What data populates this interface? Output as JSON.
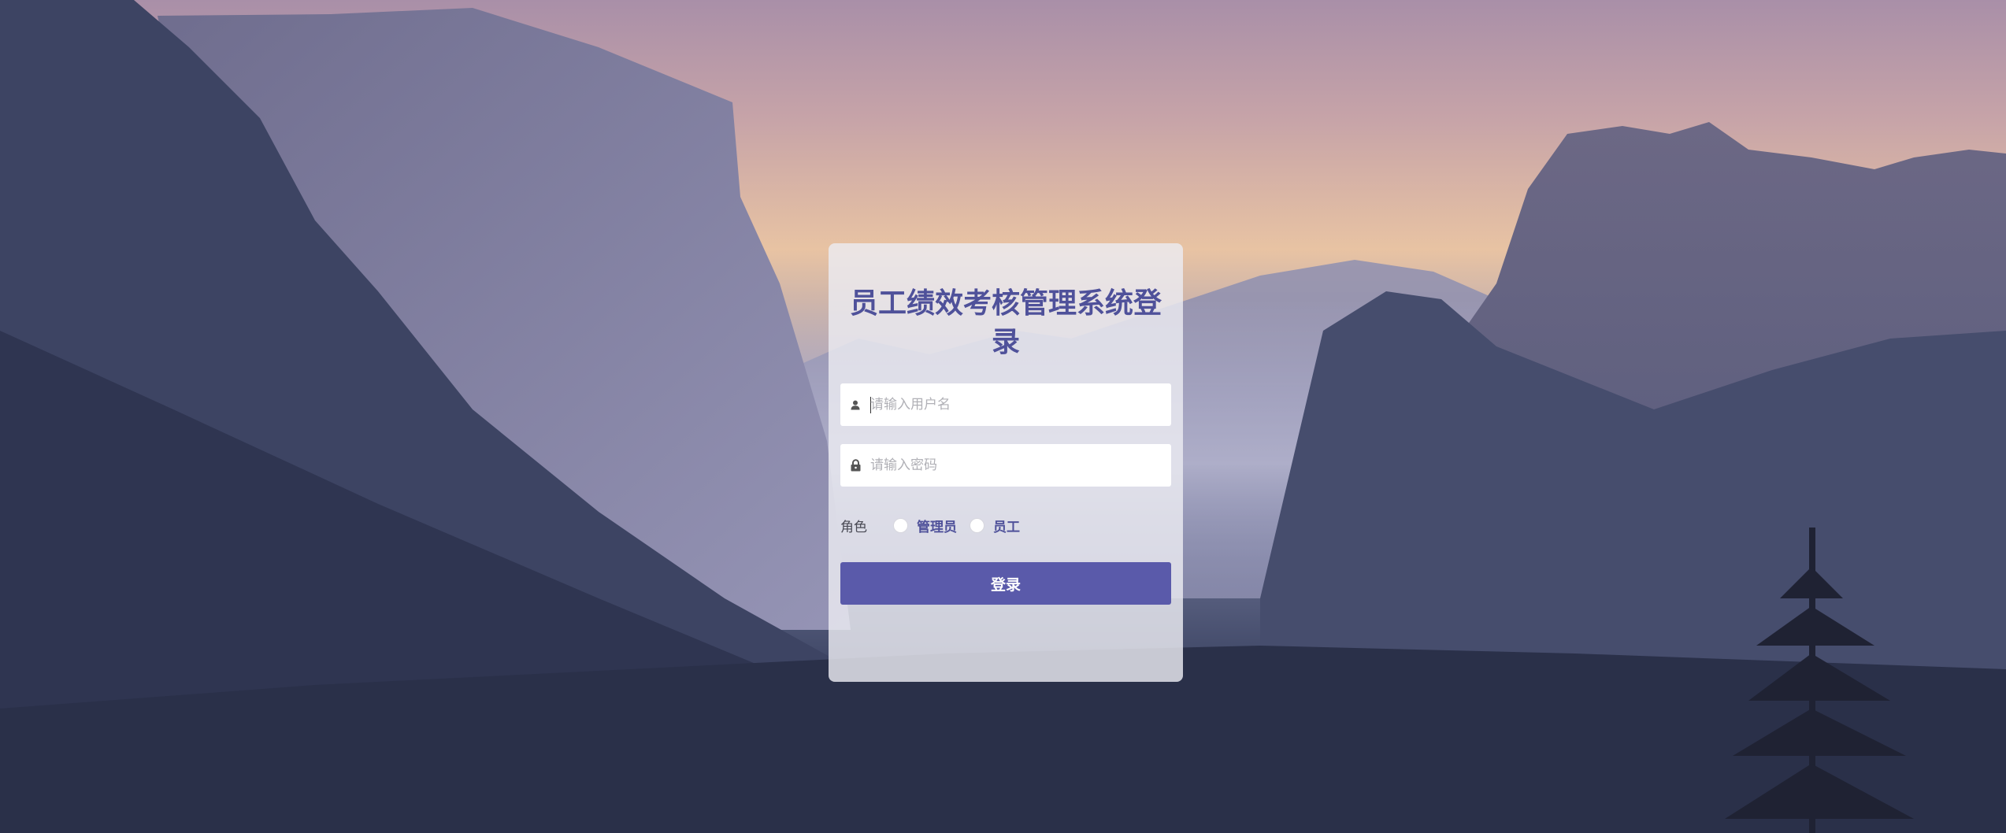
{
  "login": {
    "title": "员工绩效考核管理系统登录",
    "username_placeholder": "请输入用户名",
    "password_placeholder": "请输入密码",
    "role_label": "角色",
    "roles": [
      {
        "label": "管理员",
        "selected": false
      },
      {
        "label": "员工",
        "selected": false
      }
    ],
    "submit_label": "登录"
  },
  "colors": {
    "accent": "#5a5aaa",
    "title": "#4f519a"
  },
  "icons": {
    "username": "user-icon",
    "password": "lock-icon"
  }
}
